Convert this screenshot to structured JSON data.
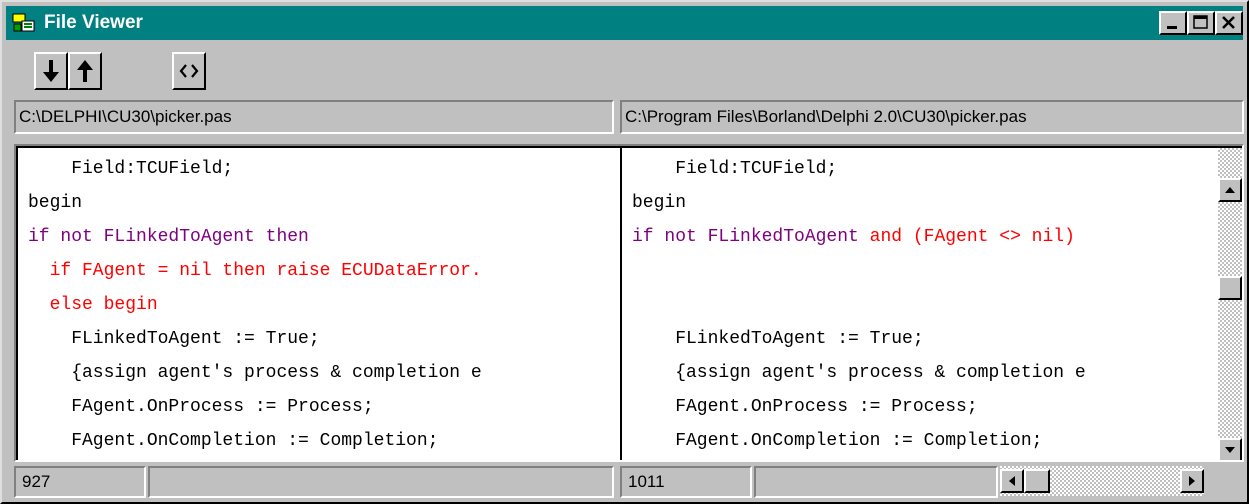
{
  "window": {
    "title": "File Viewer",
    "icon": "file-viewer-app-icon",
    "colors": {
      "titlebar": "#008080",
      "face": "#c0c0c0"
    }
  },
  "titlebar_buttons": [
    {
      "name": "minimize-button",
      "icon": "minimize-icon"
    },
    {
      "name": "maximize-button",
      "icon": "maximize-icon"
    },
    {
      "name": "close-button",
      "icon": "close-icon"
    }
  ],
  "toolbar": [
    {
      "name": "next-difference-button",
      "icon": "arrow-down-icon"
    },
    {
      "name": "previous-difference-button",
      "icon": "arrow-up-icon"
    },
    {
      "name": "compare-button",
      "icon": "angle-brackets-icon"
    }
  ],
  "left_path": "C:\\DELPHI\\CU30\\picker.pas",
  "right_path": "C:\\Program Files\\Borland\\Delphi 2.0\\CU30\\picker.pas",
  "left_lines": [
    [
      {
        "t": "    Field:TCUField;",
        "c": "black"
      }
    ],
    [
      {
        "t": "begin",
        "c": "black"
      }
    ],
    [
      {
        "t": "if not FLinkedToAgent then",
        "c": "purple"
      }
    ],
    [
      {
        "t": "  if FAgent = nil then raise ECUDataError.",
        "c": "red"
      }
    ],
    [
      {
        "t": "  else begin",
        "c": "red"
      }
    ],
    [
      {
        "t": "    FLinkedToAgent := True;",
        "c": "black"
      }
    ],
    [
      {
        "t": "    {assign agent's process & completion e",
        "c": "black"
      }
    ],
    [
      {
        "t": "    FAgent.OnProcess := Process;",
        "c": "black"
      }
    ],
    [
      {
        "t": "    FAgent.OnCompletion := Completion;",
        "c": "black"
      }
    ]
  ],
  "right_lines": [
    [
      {
        "t": "    Field:TCUField;",
        "c": "black"
      }
    ],
    [
      {
        "t": "begin",
        "c": "black"
      }
    ],
    [
      {
        "t": "if not FLinkedToAgent ",
        "c": "purple"
      },
      {
        "t": "and (FAgent <> nil)",
        "c": "red"
      }
    ],
    [],
    [],
    [
      {
        "t": "    FLinkedToAgent := True;",
        "c": "black"
      }
    ],
    [
      {
        "t": "    {assign agent's process & completion e",
        "c": "black"
      }
    ],
    [
      {
        "t": "    FAgent.OnProcess := Process;",
        "c": "black"
      }
    ],
    [
      {
        "t": "    FAgent.OnCompletion := Completion;",
        "c": "black"
      }
    ]
  ],
  "status": {
    "left_line": "927",
    "right_line": "1011"
  }
}
